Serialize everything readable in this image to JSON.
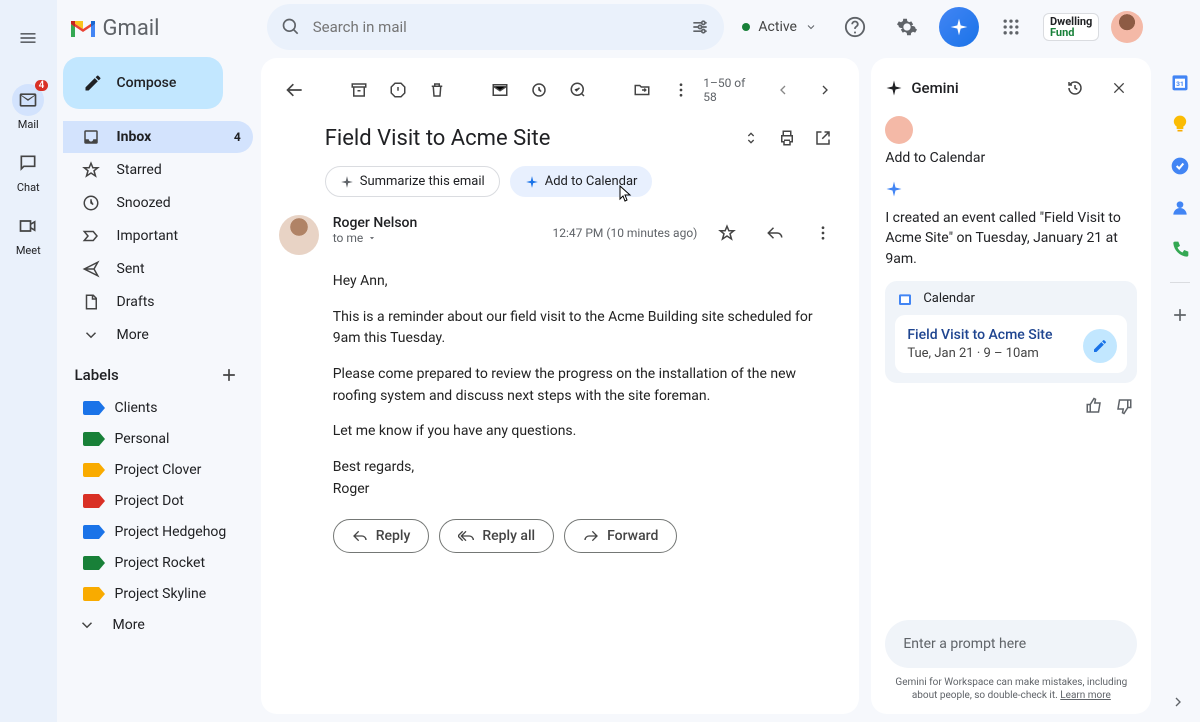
{
  "rail": {
    "items": [
      {
        "label": "Mail",
        "badge": "4"
      },
      {
        "label": "Chat"
      },
      {
        "label": "Meet"
      }
    ]
  },
  "brand": "Gmail",
  "compose": "Compose",
  "nav": [
    {
      "label": "Inbox",
      "count": "4"
    },
    {
      "label": "Starred"
    },
    {
      "label": "Snoozed"
    },
    {
      "label": "Important"
    },
    {
      "label": "Sent"
    },
    {
      "label": "Drafts"
    },
    {
      "label": "More"
    }
  ],
  "labelsHeader": "Labels",
  "labels": [
    {
      "name": "Clients",
      "color": "#1a73e8"
    },
    {
      "name": "Personal",
      "color": "#188038"
    },
    {
      "name": "Project Clover",
      "color": "#f9ab00"
    },
    {
      "name": "Project Dot",
      "color": "#d93025"
    },
    {
      "name": "Project Hedgehog",
      "color": "#1a73e8"
    },
    {
      "name": "Project Rocket",
      "color": "#188038"
    },
    {
      "name": "Project Skyline",
      "color": "#f9ab00"
    }
  ],
  "labelsMore": "More",
  "search": {
    "placeholder": "Search in mail"
  },
  "status": "Active",
  "org": {
    "line1": "Dwelling",
    "line2": "Fund"
  },
  "pager": "1–50 of 58",
  "subject": "Field Visit to Acme Site",
  "chips": {
    "summarize": "Summarize this email",
    "addcal": "Add to Calendar"
  },
  "sender": {
    "name": "Roger Nelson",
    "to": "to me",
    "time": "12:47 PM (10 minutes ago)"
  },
  "body": {
    "greeting": "Hey Ann,",
    "p1": "This is a reminder about our field visit to the Acme Building site scheduled for 9am this Tuesday.",
    "p2": "Please come prepared to review the progress on the installation of the new roofing system and discuss next steps with the site foreman.",
    "p3": "Let me know if you have any questions.",
    "sig1": "Best regards,",
    "sig2": "Roger"
  },
  "actions": {
    "reply": "Reply",
    "replyall": "Reply all",
    "forward": "Forward"
  },
  "gemini": {
    "title": "Gemini",
    "userMsg": "Add to Calendar",
    "response": "I created an event called \"Field Visit to Acme Site\" on Tuesday, January 21 at 9am.",
    "cardApp": "Calendar",
    "cardTitle": "Field Visit to Acme Site",
    "cardTime": "Tue, Jan 21 · 9 – 10am",
    "promptPlaceholder": "Enter a prompt here",
    "disclaimer": "Gemini for Workspace can make mistakes, including about people, so double-check it.",
    "learn": "Learn more"
  }
}
